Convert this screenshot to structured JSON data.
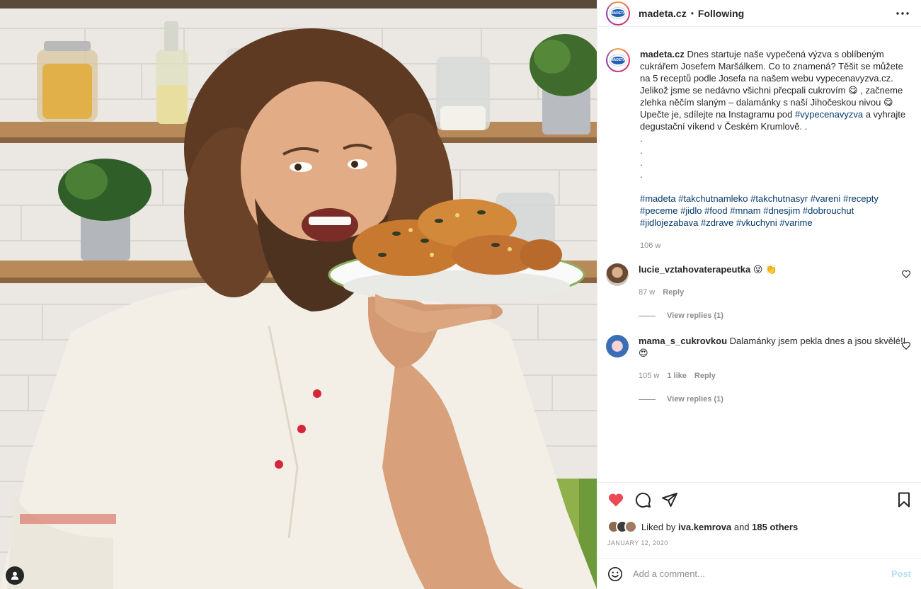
{
  "header": {
    "username": "madeta.cz",
    "separator": "•",
    "following_label": "Following"
  },
  "avatar_logo_text": "MADETA",
  "caption": {
    "username": "madeta.cz",
    "text_before_tag": "Dnes startuje naše vypečená výzva s oblíbeným cukrářem Josefem Maršálkem. Co to znamená? Těšit se můžete na 5 receptů podle Josefa na našem webu vypecenavyzva.cz. Jelikož jsme se nedávno všichni přecpali cukrovím 😋 , začneme zlehka něčím slaným – dalamánky s naší Jihočeskou nivou 😋  Upečte je, sdílejte na Instagramu pod ",
    "hashtag_inline": "#vypecenavyzva",
    "text_after_tag": " a vyhrajte degustační víkend v Českém Krumlově. .\n.\n.\n.\n.",
    "hashtags": [
      "#madeta",
      "#takchutnamleko",
      "#takchutnasyr",
      "#vareni",
      "#recepty",
      "#peceme",
      "#jidlo",
      "#food",
      "#mnam",
      "#dnesjim",
      "#dobrouchut",
      "#jidlojezabava",
      "#zdrave",
      "#vkuchyni",
      "#varime"
    ],
    "age": "106 w"
  },
  "comments": [
    {
      "username": "lucie_vztahovaterapeutka",
      "text": "😝 👏",
      "age": "87 w",
      "likes": "",
      "reply_label": "Reply",
      "view_replies": "View replies (1)"
    },
    {
      "username": "mama_s_cukrovkou",
      "text": "Dalamánky jsem pekla dnes a jsou skvělé!! 😍",
      "age": "105 w",
      "likes": "1 like",
      "reply_label": "Reply",
      "view_replies": "View replies (1)"
    }
  ],
  "likes": {
    "prefix": "Liked by",
    "user": "iva.kemrova",
    "middle": "and",
    "others": "185 others"
  },
  "date": "JANUARY 12, 2020",
  "add_comment": {
    "placeholder": "Add a comment...",
    "post_label": "Post"
  },
  "icons": {
    "more": "more-horizontal-icon",
    "heart": "heart-filled-icon",
    "comment": "comment-bubble-icon",
    "share": "paper-plane-icon",
    "save": "bookmark-icon",
    "emoji": "smiley-icon",
    "user_tag": "person-icon"
  },
  "colors": {
    "like_red": "#ed4956",
    "link_blue": "#00376b",
    "muted": "#8e8e8e",
    "post_disabled": "#b2dffc"
  }
}
